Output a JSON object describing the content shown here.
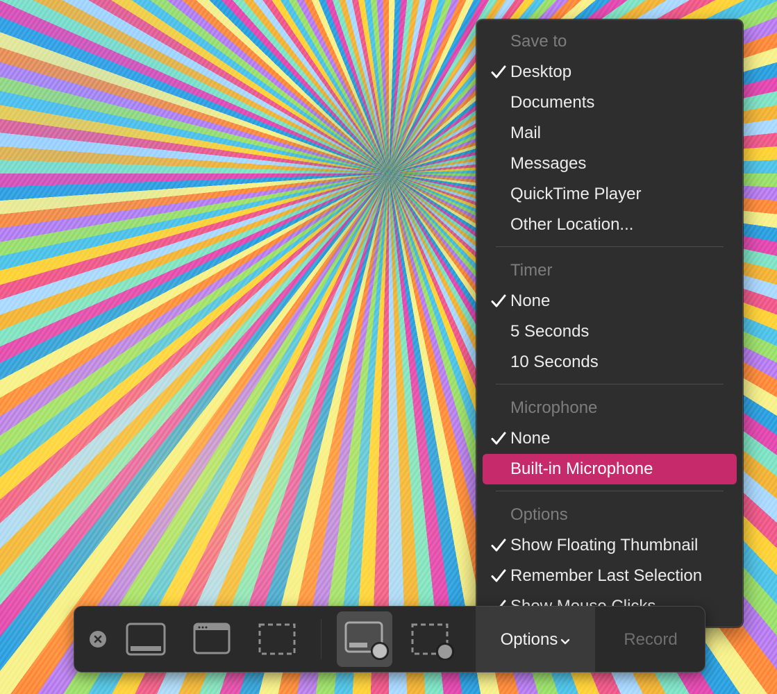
{
  "menu": {
    "save_to": {
      "header": "Save to",
      "items": [
        {
          "label": "Desktop",
          "checked": true
        },
        {
          "label": "Documents",
          "checked": false
        },
        {
          "label": "Mail",
          "checked": false
        },
        {
          "label": "Messages",
          "checked": false
        },
        {
          "label": "QuickTime Player",
          "checked": false
        },
        {
          "label": "Other Location...",
          "checked": false
        }
      ]
    },
    "timer": {
      "header": "Timer",
      "items": [
        {
          "label": "None",
          "checked": true
        },
        {
          "label": "5 Seconds",
          "checked": false
        },
        {
          "label": "10 Seconds",
          "checked": false
        }
      ]
    },
    "microphone": {
      "header": "Microphone",
      "items": [
        {
          "label": "None",
          "checked": true
        },
        {
          "label": "Built-in Microphone",
          "checked": false,
          "highlighted": true
        }
      ]
    },
    "options": {
      "header": "Options",
      "items": [
        {
          "label": "Show Floating Thumbnail",
          "checked": true
        },
        {
          "label": "Remember Last Selection",
          "checked": true
        },
        {
          "label": "Show Mouse Clicks",
          "checked": true
        }
      ]
    }
  },
  "toolbar": {
    "options_label": "Options",
    "record_label": "Record",
    "icons": [
      "close-icon",
      "capture-entire-screen-icon",
      "capture-selected-window-icon",
      "capture-selected-portion-icon",
      "record-entire-screen-icon",
      "record-selected-portion-icon",
      "chevron-down-icon"
    ]
  },
  "colors": {
    "menu_background": "#2e2e2e",
    "highlight": "#c72a6b",
    "section_header": "#7d7d7d",
    "toolbar_background": "#2a2a2a"
  }
}
